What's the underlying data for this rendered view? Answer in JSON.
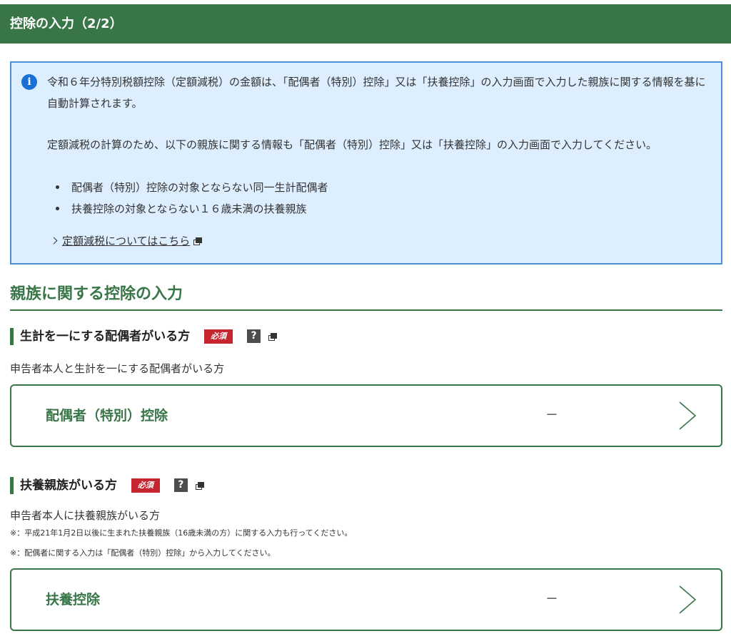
{
  "header": {
    "title": "控除の入力（2/2）"
  },
  "info": {
    "icon": "info-icon",
    "paragraph1": "令和６年分特別税額控除（定額減税）の金額は、「配偶者（特別）控除」又は「扶養控除」の入力画面で入力した親族に関する情報を基に自動計算されます。",
    "paragraph2": "定額減税の計算のため、以下の親族に関する情報も「配偶者（特別）控除」又は「扶養控除」の入力画面で入力してください。",
    "bullets": [
      "配偶者（特別）控除の対象とならない同一生計配偶者",
      "扶養控除の対象とならない１６歳未満の扶養親族"
    ],
    "link_label": "定額減税についてはこちら"
  },
  "section": {
    "title": "親族に関する控除の入力"
  },
  "spouse": {
    "heading": "生計を一にする配偶者がいる方",
    "required_label": "必須",
    "help_label": "?",
    "description": "申告者本人と生計を一にする配偶者がいる方",
    "card_label": "配偶者（特別）控除",
    "card_value": "－"
  },
  "dependents": {
    "heading": "扶養親族がいる方",
    "required_label": "必須",
    "help_label": "?",
    "description": "申告者本人に扶養親族がいる方",
    "notes": [
      "※：平成21年1月2日以後に生まれた扶養親族（16歳未満の方）に関する入力も行ってください。",
      "※：配偶者に関する入力は「配偶者（特別）控除」から入力してください。"
    ],
    "card_label": "扶養控除",
    "card_value": "－"
  },
  "colors": {
    "brand_green": "#387648",
    "info_background": "#ddeeff",
    "info_border": "#4a8fd8",
    "required_red": "#c6252f"
  }
}
